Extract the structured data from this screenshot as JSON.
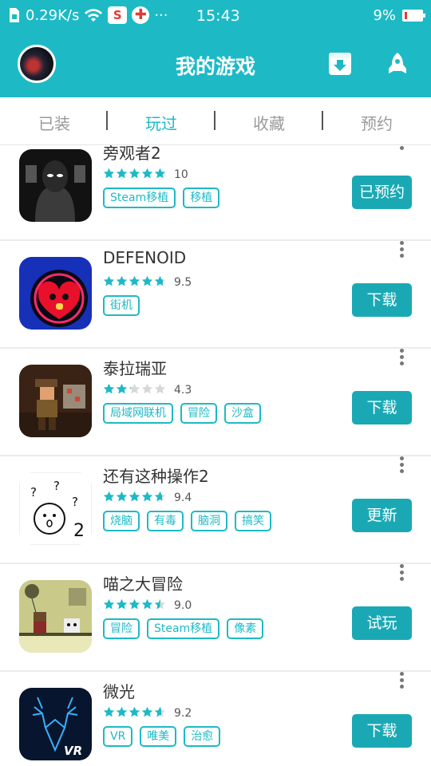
{
  "status_bar": {
    "speed": "0.29K/s",
    "time": "15:43",
    "battery": "9%",
    "s_badge": "S",
    "dots": "···"
  },
  "header": {
    "title": "我的游戏"
  },
  "tabs": [
    {
      "label": "已装",
      "active": false
    },
    {
      "label": "玩过",
      "active": true
    },
    {
      "label": "收藏",
      "active": false
    },
    {
      "label": "预约",
      "active": false
    }
  ],
  "games": [
    {
      "name": "旁观者2",
      "rating": 10,
      "score": "10",
      "tags": [
        "Steam移植",
        "移植"
      ],
      "action": "已预约",
      "icon": "beholder-icon"
    },
    {
      "name": "DEFENOID",
      "rating": 9.5,
      "score": "9.5",
      "tags": [
        "街机"
      ],
      "action": "下载",
      "icon": "defenoid-icon"
    },
    {
      "name": "泰拉瑞亚",
      "rating": 4.3,
      "score": "4.3",
      "tags": [
        "局域网联机",
        "冒险",
        "沙盒"
      ],
      "action": "下载",
      "icon": "terraria-icon"
    },
    {
      "name": "还有这种操作2",
      "rating": 9.4,
      "score": "9.4",
      "tags": [
        "烧脑",
        "有毒",
        "脑洞",
        "搞笑"
      ],
      "action": "更新",
      "icon": "stickman-puzzle-icon"
    },
    {
      "name": "喵之大冒险",
      "rating": 9.0,
      "score": "9.0",
      "tags": [
        "冒险",
        "Steam移植",
        "像素"
      ],
      "action": "试玩",
      "icon": "cat-adventure-icon"
    },
    {
      "name": "微光",
      "rating": 9.2,
      "score": "9.2",
      "tags": [
        "VR",
        "唯美",
        "治愈"
      ],
      "action": "下载",
      "icon": "deer-icon"
    }
  ],
  "colors": {
    "accent": "#1dbac6",
    "button": "#1aa9b4",
    "star_empty": "#d8d8d8"
  }
}
